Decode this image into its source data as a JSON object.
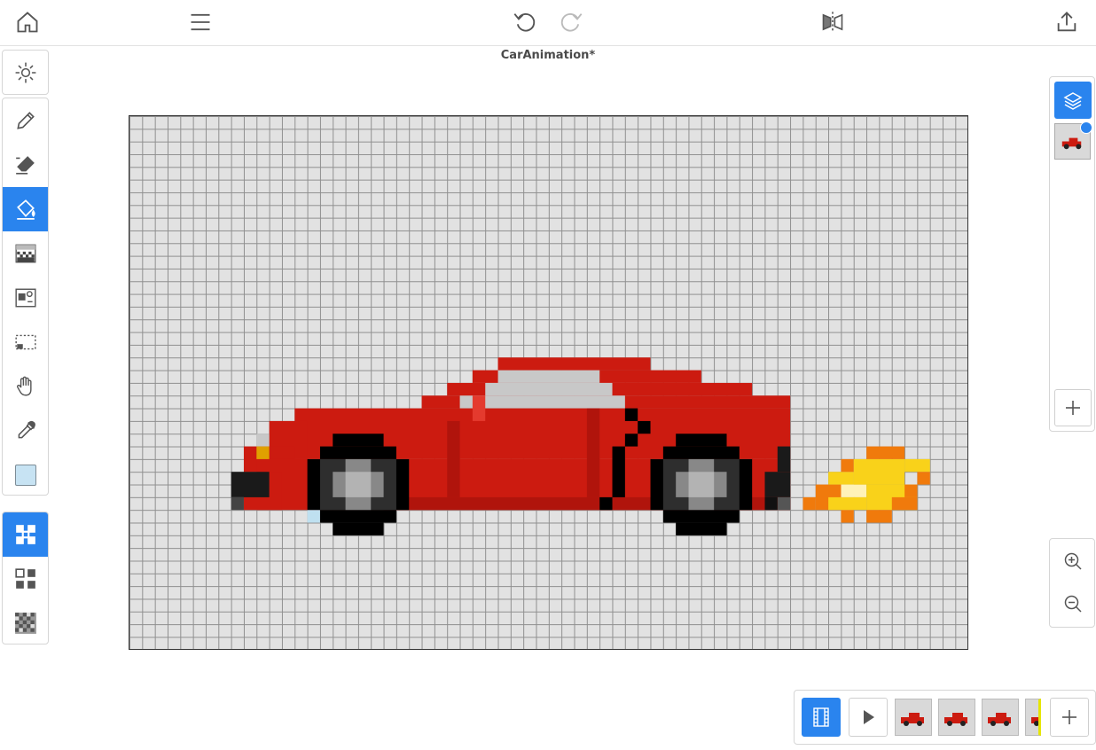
{
  "app": {
    "title": "CarAnimation*"
  },
  "topbar": {
    "icons": [
      "home-icon",
      "menu-icon",
      "undo-icon",
      "redo-icon",
      "mirror-icon",
      "share-icon"
    ]
  },
  "tools": {
    "top_group": [
      "brightness-icon"
    ],
    "draw_group": [
      "pencil-icon",
      "eraser-icon",
      "fill-bucket-icon",
      "dither-icon",
      "image-icon",
      "selection-icon",
      "hand-icon",
      "eyedropper-icon",
      "color-swatch"
    ],
    "active_tool": "fill-bucket-icon",
    "current_color": "#c7e3f3",
    "bottom_group": [
      "pixel-grid-icon",
      "tile-icon",
      "noise-icon"
    ]
  },
  "layers": {
    "count": 1
  },
  "timeline": {
    "frames": 4
  },
  "colors": {
    "accent": "#2a84ee",
    "canvas_bg": "#e2e2e2",
    "grid": "#8f8f8f",
    "car_red": "#cc1b10",
    "car_shade": "#b0140c",
    "window": "#c8c8c8",
    "tire": "#000000",
    "rim_dark": "#2e2e2e",
    "rim_light": "#b3b3b3",
    "flame_orange": "#f07a0c",
    "flame_yellow": "#f9d21a",
    "flame_light": "#fff2b8"
  }
}
